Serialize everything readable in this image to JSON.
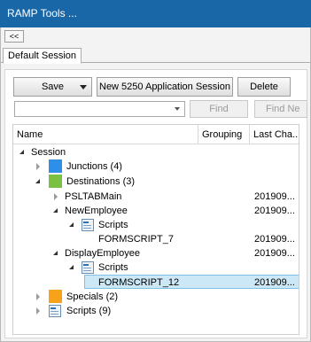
{
  "window": {
    "title": "RAMP Tools ..."
  },
  "collapse_button": {
    "label": "<<"
  },
  "tabs": [
    {
      "label": "Default Session"
    }
  ],
  "toolbar": {
    "save_label": "Save",
    "new_session_label": "New 5250 Application Session",
    "delete_label": "Delete",
    "find_label": "Find",
    "find_next_label": "Find Ne"
  },
  "search": {
    "value": ""
  },
  "columns": {
    "name": "Name",
    "grouping": "Grouping",
    "last_changed": "Last Cha..."
  },
  "tree": {
    "session": "Session",
    "junctions": "Junctions (4)",
    "destinations": "Destinations (3)",
    "psltabmain": "PSLTABMain",
    "psltabmain_date": "201909...",
    "newemployee": "NewEmployee",
    "newemployee_date": "201909...",
    "scripts_a": "Scripts",
    "formscript7": "FORMSCRIPT_7",
    "formscript7_date": "201909...",
    "displayemployee": "DisplayEmployee",
    "displayemployee_date": "201909...",
    "scripts_b": "Scripts",
    "formscript12": "FORMSCRIPT_12",
    "formscript12_date": "201909...",
    "specials": "Specials (2)",
    "scripts_root": "Scripts (9)"
  },
  "colors": {
    "titlebar": "#1a67a8",
    "junctions": "#2e8fe8",
    "destinations": "#7ac143",
    "specials": "#f7a21b",
    "selection": "#cce8f6"
  },
  "icons": {
    "junctions": "blue-square-icon",
    "destinations": "green-square-icon",
    "specials": "orange-square-icon",
    "scripts": "script-document-icon"
  }
}
